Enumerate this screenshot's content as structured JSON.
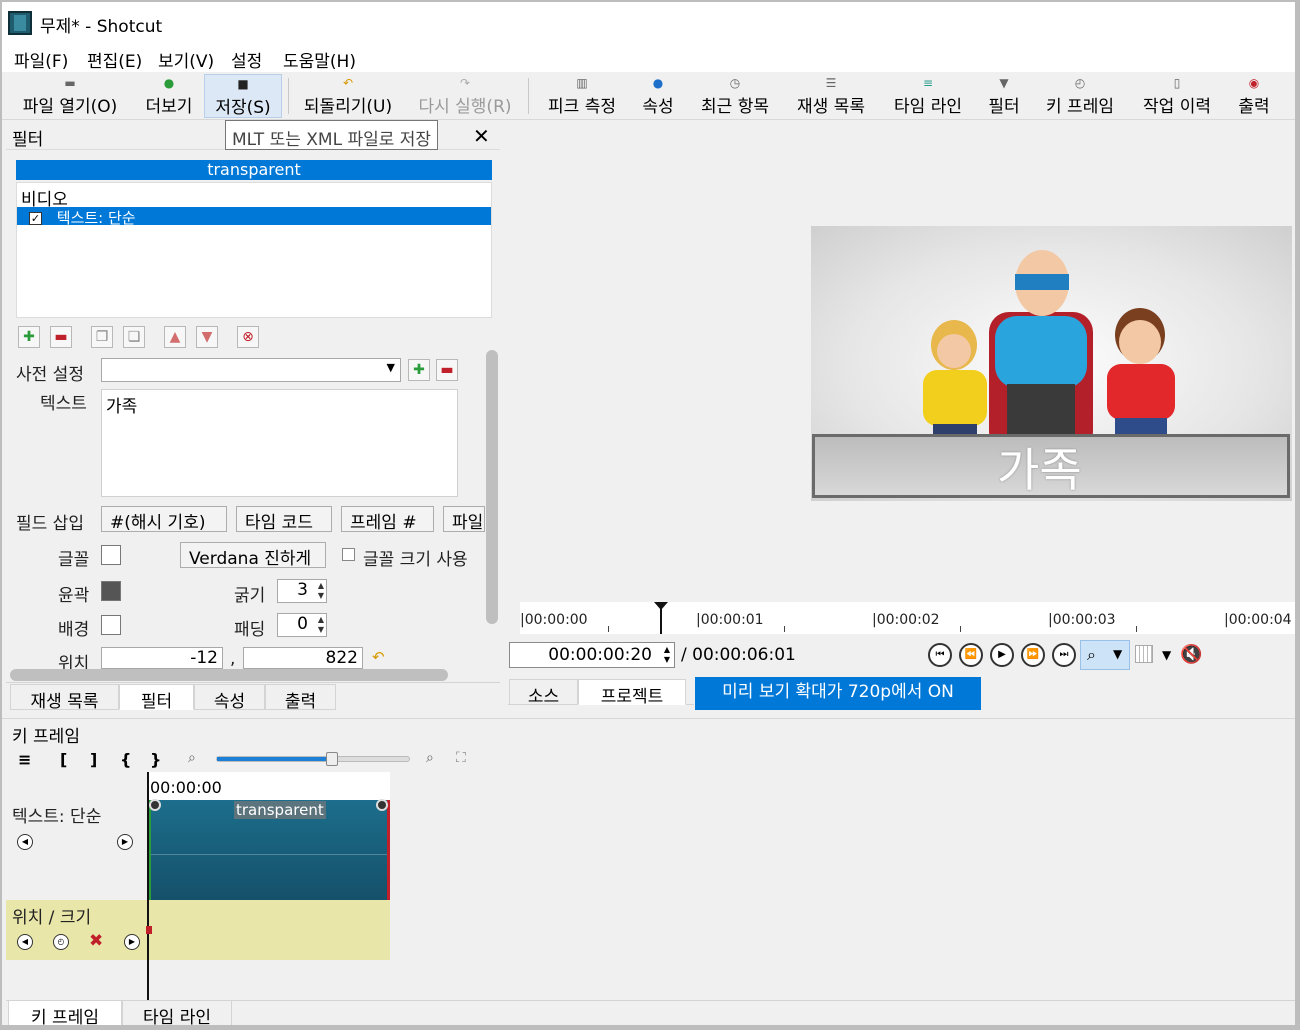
{
  "window": {
    "title": "무제* - Shotcut"
  },
  "menu": [
    "파일(F)",
    "편집(E)",
    "보기(V)",
    "설정",
    "도움말(H)"
  ],
  "toolbar": {
    "open": "파일 열기(O)",
    "more": "더보기",
    "save": "저장(S)",
    "undo": "되돌리기(U)",
    "redo": "다시 실행(R)",
    "peak": "피크 측정",
    "properties": "속성",
    "recent": "최근 항목",
    "playlist": "재생 목록",
    "timeline": "타임 라인",
    "filter": "필터",
    "keyframe": "키 프레임",
    "history": "작업 이력",
    "export": "출력"
  },
  "tooltip": "MLT 또는 XML 파일로 저장",
  "filter_panel": {
    "title": "필터",
    "selected_clip": "transparent",
    "category": "비디오",
    "filter_item": "텍스트: 단순",
    "preset_label": "사전 설정",
    "text_label": "텍스트",
    "text_value": "가족",
    "insert_field_label": "필드 삽입",
    "insert_buttons": [
      "#(해시 기호)",
      "타임 코드",
      "프레임 #",
      "파일"
    ],
    "font_label": "글꼴",
    "font_button": "Verdana 진하게",
    "font_size_check": "글꼴 크기 사용",
    "outline_label": "윤곽",
    "thickness_label": "굵기",
    "thickness_value": "3",
    "bg_label": "배경",
    "padding_label": "패딩",
    "padding_value": "0",
    "position_label": "위치",
    "pos_x": "-12",
    "pos_sep": ",",
    "pos_y": "822",
    "outline_color": "#555555"
  },
  "left_tabs": [
    "재생 목록",
    "필터",
    "속성",
    "출력"
  ],
  "player": {
    "caption": "가족",
    "ruler": [
      "|00:00:00",
      "|00:00:01",
      "|00:00:02",
      "|00:00:03",
      "|00:00:04"
    ],
    "timecode": "00:00:00:20",
    "duration": "/ 00:00:06:01",
    "tabs": [
      "소스",
      "프로젝트"
    ],
    "preview_badge": "미리 보기 확대가 720p에서 ON"
  },
  "keyframes": {
    "title": "키 프레임",
    "toolbar": [
      "≡",
      "[",
      "]",
      "{",
      "}"
    ],
    "zoom_level": 0.6,
    "ruler_time": "00:00:00",
    "track1": "텍스트: 단순",
    "clip_name": "transparent",
    "track2": "위치 / 크기"
  },
  "bottom_tabs": [
    "키 프레임",
    "타임 라인"
  ],
  "colors": {
    "accent": "#0078d7",
    "clip": "#1c6e8c",
    "track_param": "#e8e6a8"
  }
}
